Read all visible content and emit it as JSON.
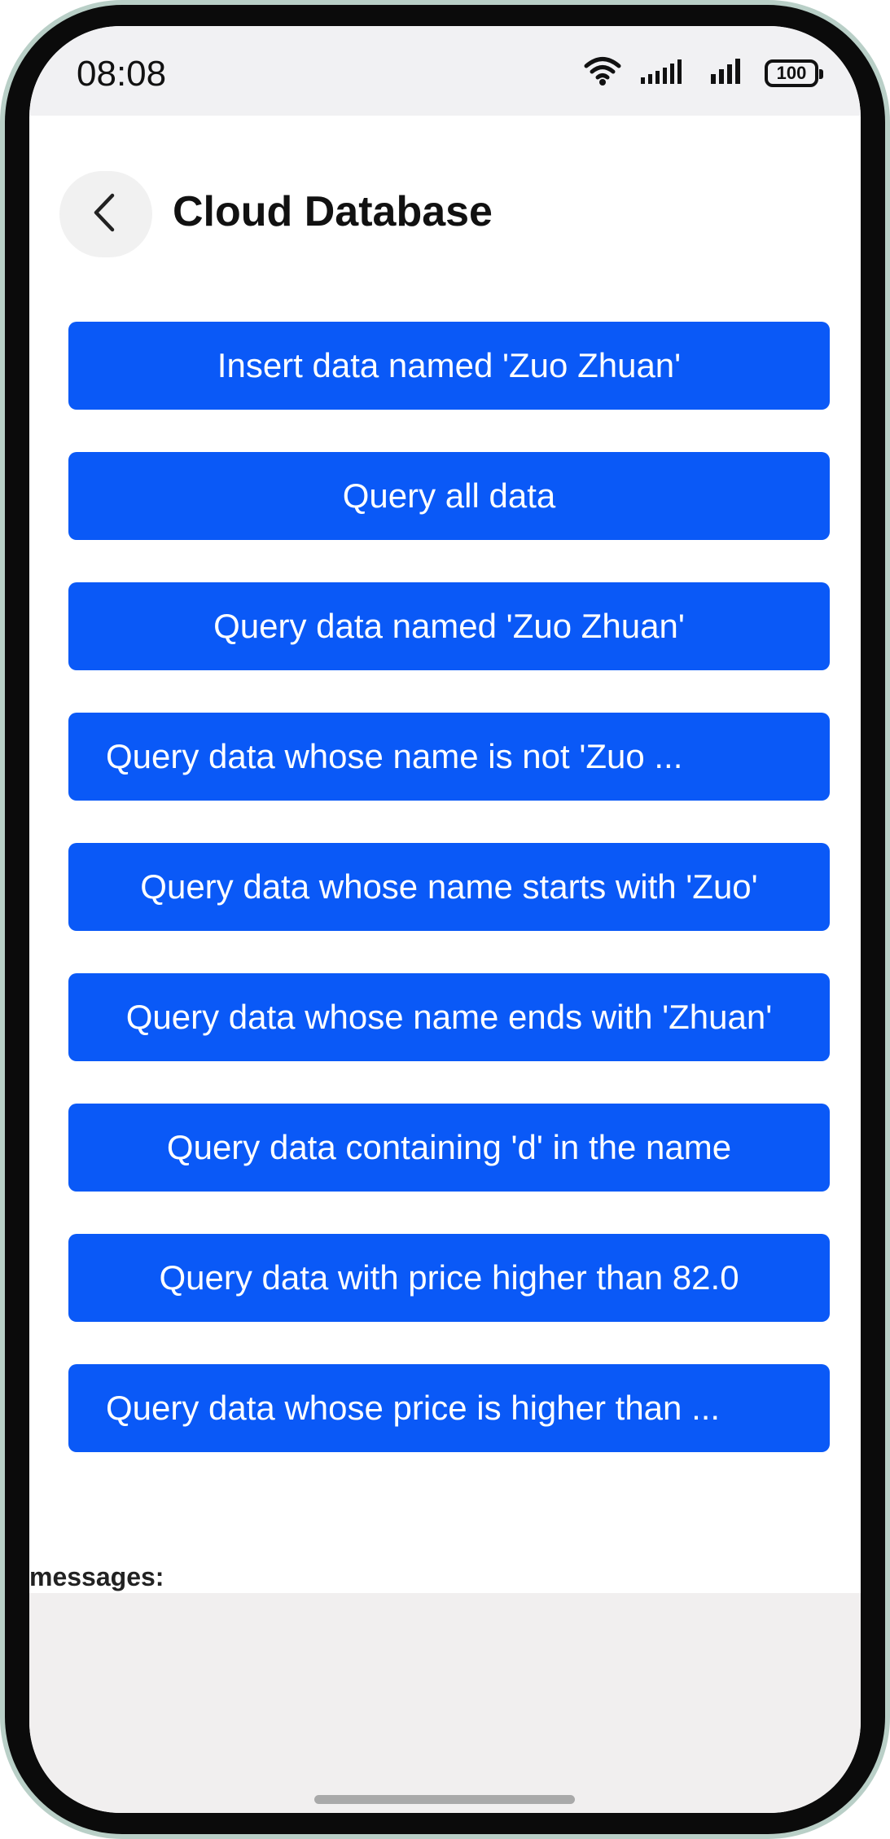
{
  "status_bar": {
    "time": "08:08",
    "battery": "100"
  },
  "header": {
    "title": "Cloud Database"
  },
  "actions": [
    "Insert data named 'Zuo Zhuan'",
    "Query all data",
    "Query data named 'Zuo Zhuan'",
    "Query data whose name is not 'Zuo ...",
    "Query data whose name starts with 'Zuo'",
    "Query data whose name ends with 'Zhuan'",
    "Query data containing 'd' in the name",
    "Query data with price higher than 82.0",
    "Query data whose price is higher than ..."
  ],
  "messages": {
    "label": "messages:"
  }
}
